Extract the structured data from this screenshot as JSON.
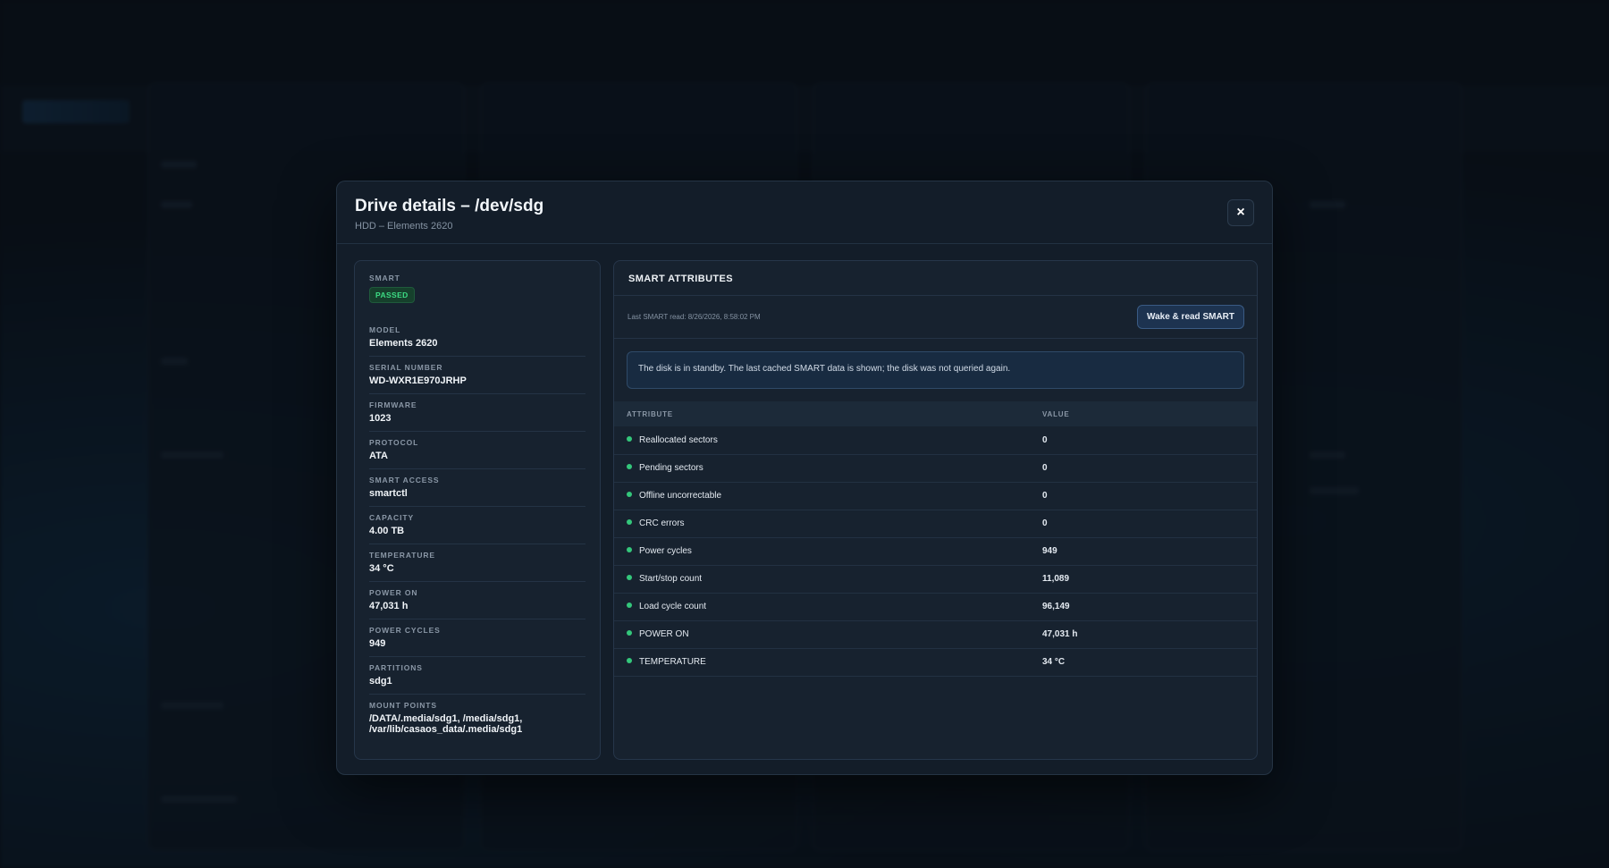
{
  "modal": {
    "title": "Drive details – /dev/sdg",
    "subtitle": "HDD – Elements 2620",
    "close_label": "×"
  },
  "details": {
    "smart_label": "SMART",
    "smart_status": "PASSED",
    "smart_status_color": "#3ddc84",
    "fields": [
      {
        "label": "MODEL",
        "value": "Elements 2620"
      },
      {
        "label": "SERIAL NUMBER",
        "value": "WD-WXR1E970JRHP"
      },
      {
        "label": "FIRMWARE",
        "value": "1023"
      },
      {
        "label": "PROTOCOL",
        "value": "ATA"
      },
      {
        "label": "SMART ACCESS",
        "value": "smartctl"
      },
      {
        "label": "CAPACITY",
        "value": "4.00 TB"
      },
      {
        "label": "TEMPERATURE",
        "value": "34 °C"
      },
      {
        "label": "POWER ON",
        "value": "47,031 h"
      },
      {
        "label": "POWER CYCLES",
        "value": "949"
      },
      {
        "label": "PARTITIONS",
        "value": "sdg1"
      },
      {
        "label": "MOUNT POINTS",
        "value": "/DATA/.media/sdg1, /media/sdg1, /var/lib/casaos_data/.media/sdg1"
      }
    ]
  },
  "smart": {
    "heading": "SMART ATTRIBUTES",
    "last_read": "Last SMART read: 8/26/2026, 8:58:02 PM",
    "wake_button": "Wake & read SMART",
    "notice": "The disk is in standby. The last cached SMART data is shown; the disk was not queried again.",
    "columns": [
      "ATTRIBUTE",
      "VALUE"
    ],
    "status_dot_color": "#34c77b",
    "rows": [
      {
        "attribute": "Reallocated sectors",
        "value": "0"
      },
      {
        "attribute": "Pending sectors",
        "value": "0"
      },
      {
        "attribute": "Offline uncorrectable",
        "value": "0"
      },
      {
        "attribute": "CRC errors",
        "value": "0"
      },
      {
        "attribute": "Power cycles",
        "value": "949"
      },
      {
        "attribute": "Start/stop count",
        "value": "11,089"
      },
      {
        "attribute": "Load cycle count",
        "value": "96,149"
      },
      {
        "attribute": "POWER ON",
        "value": "47,031 h"
      },
      {
        "attribute": "TEMPERATURE",
        "value": "34 °C"
      }
    ]
  }
}
